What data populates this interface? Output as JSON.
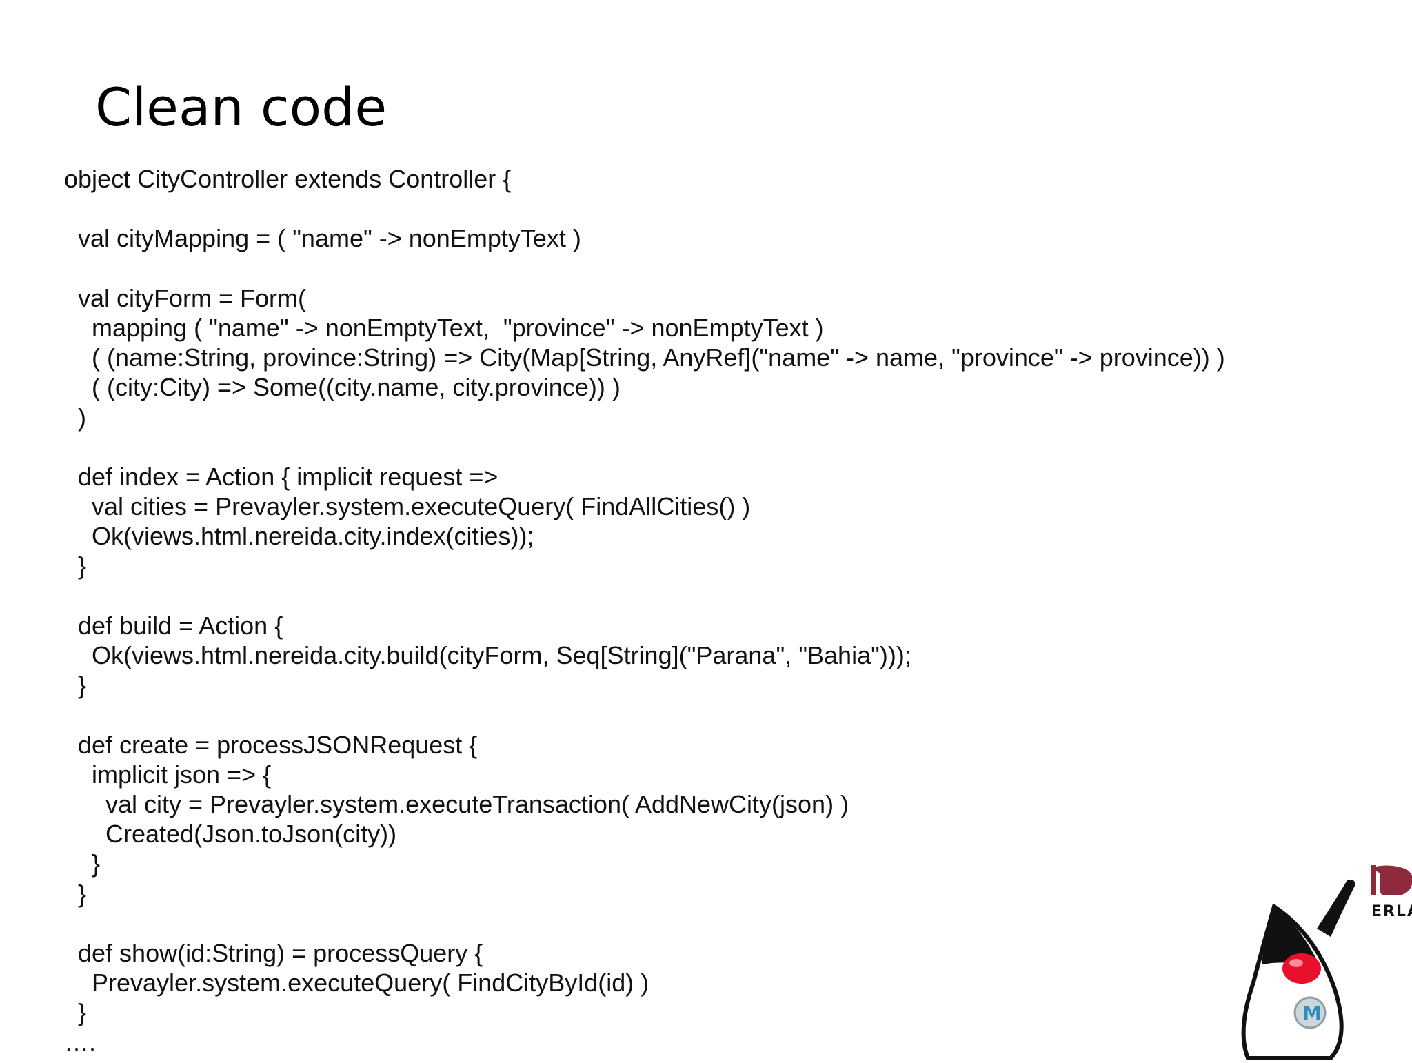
{
  "slide": {
    "title": "Clean code"
  },
  "code": {
    "lines": [
      "object CityController extends Controller {",
      "",
      "  val cityMapping = ( \"name\" -> nonEmptyText )",
      "",
      "  val cityForm = Form(",
      "    mapping ( \"name\" -> nonEmptyText,  \"province\" -> nonEmptyText )",
      "    ( (name:String, province:String) => City(Map[String, AnyRef](\"name\" -> name, \"province\" -> province)) )",
      "    ( (city:City) => Some((city.name, city.province)) )",
      "  )",
      "",
      "  def index = Action { implicit request =>",
      "    val cities = Prevayler.system.executeQuery( FindAllCities() )",
      "    Ok(views.html.nereida.city.index(cities));",
      "  }",
      "",
      "  def build = Action {",
      "    Ok(views.html.nereida.city.build(cityForm, Seq[String](\"Parana\", \"Bahia\")));",
      "  }",
      "",
      "  def create = processJSONRequest {",
      "    implicit json => {",
      "      val city = Prevayler.system.executeTransaction( AddNewCity(json) )",
      "      Created(Json.toJson(city))",
      "    }",
      "  }",
      "",
      "  def show(id:String) = processQuery {",
      "    Prevayler.system.executeQuery( FindCityById(id) )",
      "  }",
      "…."
    ]
  },
  "logos": {
    "erlang_text": "ERLANG",
    "erlang_color": "#8e2a3c",
    "duke_nose_color": "#e8102a",
    "mule_badge_color": "#2a8fbf"
  }
}
